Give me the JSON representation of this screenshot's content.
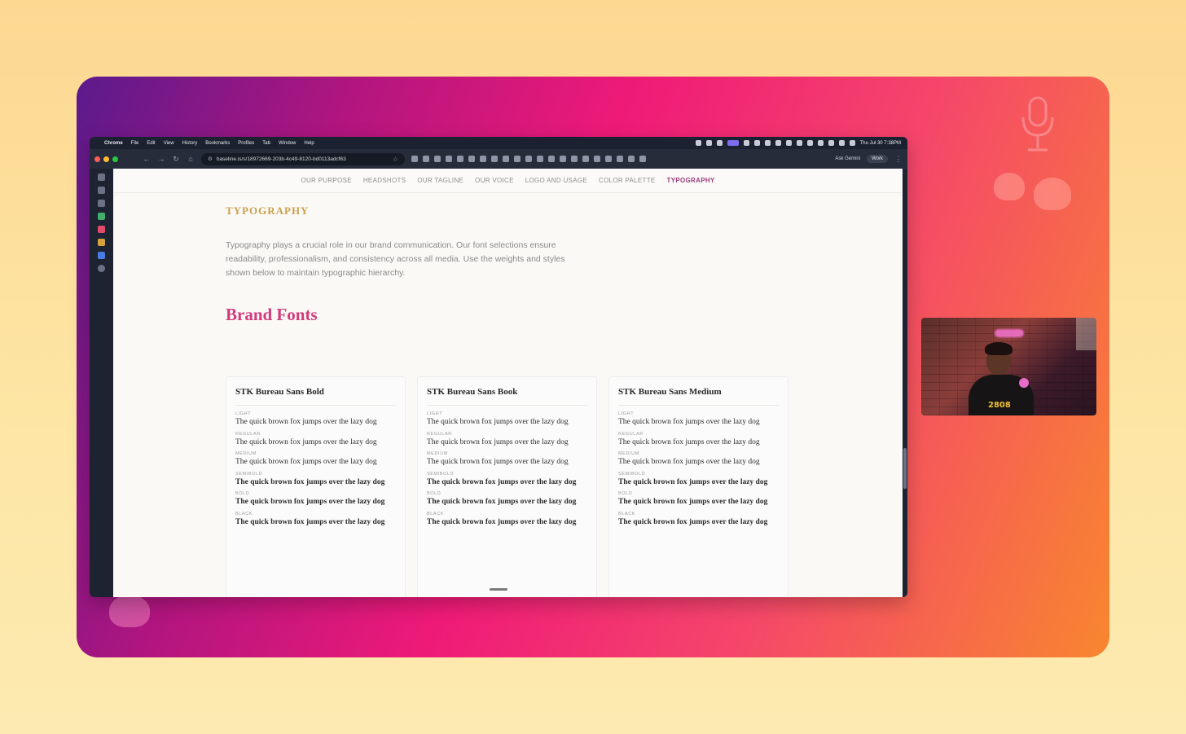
{
  "menubar": {
    "app": "Chrome",
    "items": [
      "File",
      "Edit",
      "View",
      "History",
      "Bookmarks",
      "Profiles",
      "Tab",
      "Window",
      "Help"
    ],
    "clock": "Thu Jul 30  7:38PM"
  },
  "toolbar": {
    "url": "baseline.is/s/18972669-203b-4c49-8120-bd0113adcf63",
    "ask_gemini": "Ask Gemini",
    "profile": "Work"
  },
  "nav": {
    "items": [
      "OUR PURPOSE",
      "HEADSHOTS",
      "OUR TAGLINE",
      "OUR VOICE",
      "LOGO AND USAGE",
      "COLOR PALETTE",
      "TYPOGRAPHY"
    ],
    "active": "TYPOGRAPHY"
  },
  "section": {
    "title": "TYPOGRAPHY",
    "intro": "Typography plays a crucial role in our brand communication. Our font selections ensure readability, professionalism, and consistency across all media. Use the weights and styles shown below to maintain typographic hierarchy.",
    "brand_fonts_title": "Brand Fonts"
  },
  "fonts": [
    {
      "name": "STK Bureau Sans Bold",
      "weights": [
        {
          "label": "LIGHT",
          "sample": "The quick brown fox jumps over the lazy dog"
        },
        {
          "label": "REGULAR",
          "sample": "The quick brown fox jumps over the lazy dog"
        },
        {
          "label": "MEDIUM",
          "sample": "The quick brown fox jumps over the lazy dog"
        },
        {
          "label": "SEMIBOLD",
          "sample": "The quick brown fox jumps over the lazy dog"
        },
        {
          "label": "BOLD",
          "sample": "The quick brown fox jumps over the lazy dog"
        },
        {
          "label": "BLACK",
          "sample": "The quick brown fox jumps over the lazy dog"
        }
      ]
    },
    {
      "name": "STK Bureau Sans Book",
      "weights": [
        {
          "label": "LIGHT",
          "sample": "The quick brown fox jumps over the lazy dog"
        },
        {
          "label": "REGULAR",
          "sample": "The quick brown fox jumps over the lazy dog"
        },
        {
          "label": "MEDIUM",
          "sample": "The quick brown fox jumps over the lazy dog"
        },
        {
          "label": "SEMIBOLD",
          "sample": "The quick brown fox jumps over the lazy dog"
        },
        {
          "label": "BOLD",
          "sample": "The quick brown fox jumps over the lazy dog"
        },
        {
          "label": "BLACK",
          "sample": "The quick brown fox jumps over the lazy dog"
        }
      ]
    },
    {
      "name": "STK Bureau Sans Medium",
      "weights": [
        {
          "label": "LIGHT",
          "sample": "The quick brown fox jumps over the lazy dog"
        },
        {
          "label": "REGULAR",
          "sample": "The quick brown fox jumps over the lazy dog"
        },
        {
          "label": "MEDIUM",
          "sample": "The quick brown fox jumps over the lazy dog"
        },
        {
          "label": "SEMIBOLD",
          "sample": "The quick brown fox jumps over the lazy dog"
        },
        {
          "label": "BOLD",
          "sample": "The quick brown fox jumps over the lazy dog"
        },
        {
          "label": "BLACK",
          "sample": "The quick brown fox jumps over the lazy dog"
        }
      ]
    }
  ],
  "webcam": {
    "shirt_text": "2808"
  },
  "colors": {
    "accent_title": "#c9a14f",
    "brand_pink": "#d23b7c",
    "nav_active": "#9a3d7a"
  }
}
